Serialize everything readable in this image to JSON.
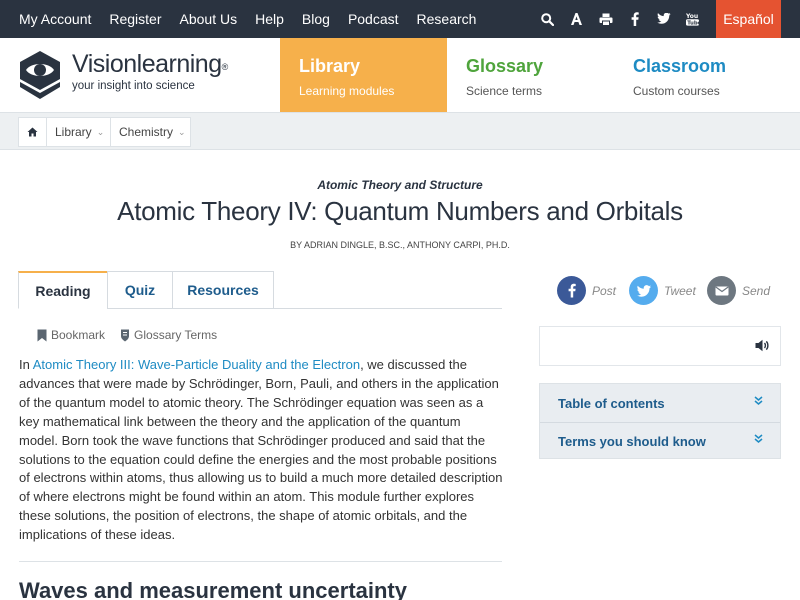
{
  "topnav": {
    "links": [
      "My Account",
      "Register",
      "About Us",
      "Help",
      "Blog",
      "Podcast",
      "Research"
    ],
    "icons": [
      "search-icon",
      "font-size-icon",
      "print-icon",
      "facebook-icon",
      "twitter-icon",
      "youtube-icon"
    ],
    "language_button": "Español"
  },
  "logo": {
    "name": "Visionlearning",
    "registered": "®",
    "tagline": "your insight into science"
  },
  "main_nav": [
    {
      "title": "Library",
      "subtitle": "Learning modules"
    },
    {
      "title": "Glossary",
      "subtitle": "Science terms"
    },
    {
      "title": "Classroom",
      "subtitle": "Custom courses"
    }
  ],
  "breadcrumb": {
    "home_icon": "home-icon",
    "items": [
      "Library",
      "Chemistry"
    ]
  },
  "article": {
    "kicker": "Atomic Theory and Structure",
    "title": "Atomic Theory IV: Quantum Numbers and Orbitals",
    "byline": "BY ADRIAN DINGLE, B.SC., ANTHONY CARPI, PH.D.",
    "tabs": [
      "Reading",
      "Quiz",
      "Resources"
    ],
    "tools": [
      "Bookmark",
      "Glossary Terms"
    ],
    "intro_prefix": "In ",
    "intro_link": "Atomic Theory III: Wave-Particle Duality and the Electron",
    "intro_rest": ", we discussed the advances that were made by Schrödinger, Born, Pauli, and others in the application of the quantum model to atomic theory. The Schrödinger equation was seen as a key mathematical link between the theory and the application of the quantum model. Born took the wave functions that Schrödinger produced and said that the solutions to the equation could define the energies and the most probable positions of electrons within atoms, thus allowing us to build a much more detailed description of where electrons might be found within an atom. This module further explores these solutions, the position of electrons, the shape of atomic orbitals, and the implications of these ideas.",
    "section_heading": "Waves and measurement uncertainty"
  },
  "share": [
    "Post",
    "Tweet",
    "Send"
  ],
  "sidebar": {
    "audio_icon": "speaker-icon",
    "panels": [
      "Table of contents",
      "Terms you should know"
    ]
  },
  "colors": {
    "topbar": "#2a3340",
    "library": "#f6b04b",
    "glossary": "#4fa43c",
    "classroom": "#1e8bc3",
    "espanol": "#e55331",
    "facebook": "#3b5998",
    "twitter": "#55acee",
    "email": "#6d7780"
  }
}
